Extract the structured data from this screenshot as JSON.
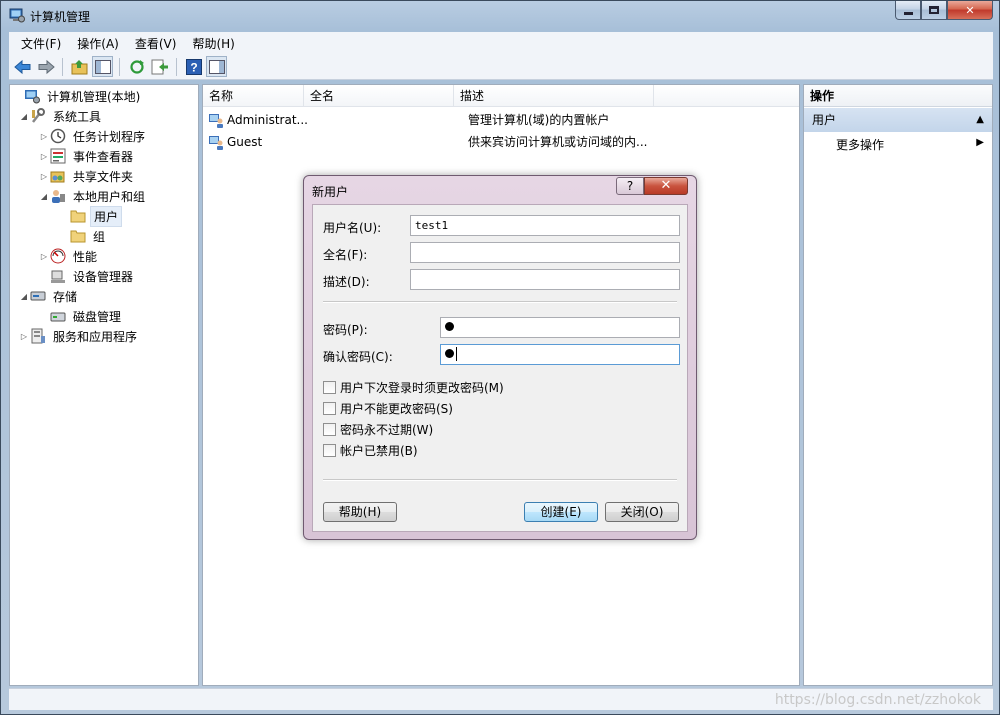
{
  "window": {
    "title": "计算机管理"
  },
  "menu": [
    "文件(F)",
    "操作(A)",
    "查看(V)",
    "帮助(H)"
  ],
  "toolbar": {
    "icons": [
      "back-arrow-icon",
      "forward-arrow-icon",
      "up-folder-icon",
      "show-hide-tree-icon",
      "refresh-icon",
      "export-list-icon",
      "help-icon",
      "show-hide-action-pane-icon"
    ]
  },
  "tree": {
    "root": "计算机管理(本地)",
    "system_tools": "系统工具",
    "task_scheduler": "任务计划程序",
    "event_viewer": "事件查看器",
    "shared_folders": "共享文件夹",
    "local_users_groups": "本地用户和组",
    "users": "用户",
    "groups": "组",
    "performance": "性能",
    "device_manager": "设备管理器",
    "storage": "存储",
    "disk_management": "磁盘管理",
    "services_apps": "服务和应用程序"
  },
  "list": {
    "columns": [
      "名称",
      "全名",
      "描述"
    ],
    "rows": [
      {
        "name": "Administrat...",
        "fullname": "",
        "desc": "管理计算机(域)的内置帐户"
      },
      {
        "name": "Guest",
        "fullname": "",
        "desc": "供来宾访问计算机或访问域的内..."
      }
    ]
  },
  "actions": {
    "header": "操作",
    "group": "用户",
    "more": "更多操作"
  },
  "status": {
    "watermark": "https://blog.csdn.net/zzhokok"
  },
  "dialog": {
    "title": "新用户",
    "help_glyph": "?",
    "close_glyph": "✕",
    "username_label": "用户名(U):",
    "username_value": "test1",
    "fullname_label": "全名(F):",
    "fullname_value": "",
    "description_label": "描述(D):",
    "description_value": "",
    "password_label": "密码(P):",
    "confirm_label": "确认密码(C):",
    "checkboxes": [
      {
        "label": "用户下次登录时须更改密码(M)",
        "checked": false
      },
      {
        "label": "用户不能更改密码(S)",
        "checked": false
      },
      {
        "label": "密码永不过期(W)",
        "checked": false
      },
      {
        "label": "帐户已禁用(B)",
        "checked": false
      }
    ],
    "help_button": "帮助(H)",
    "create_button": "创建(E)",
    "close_button": "关闭(O)"
  }
}
